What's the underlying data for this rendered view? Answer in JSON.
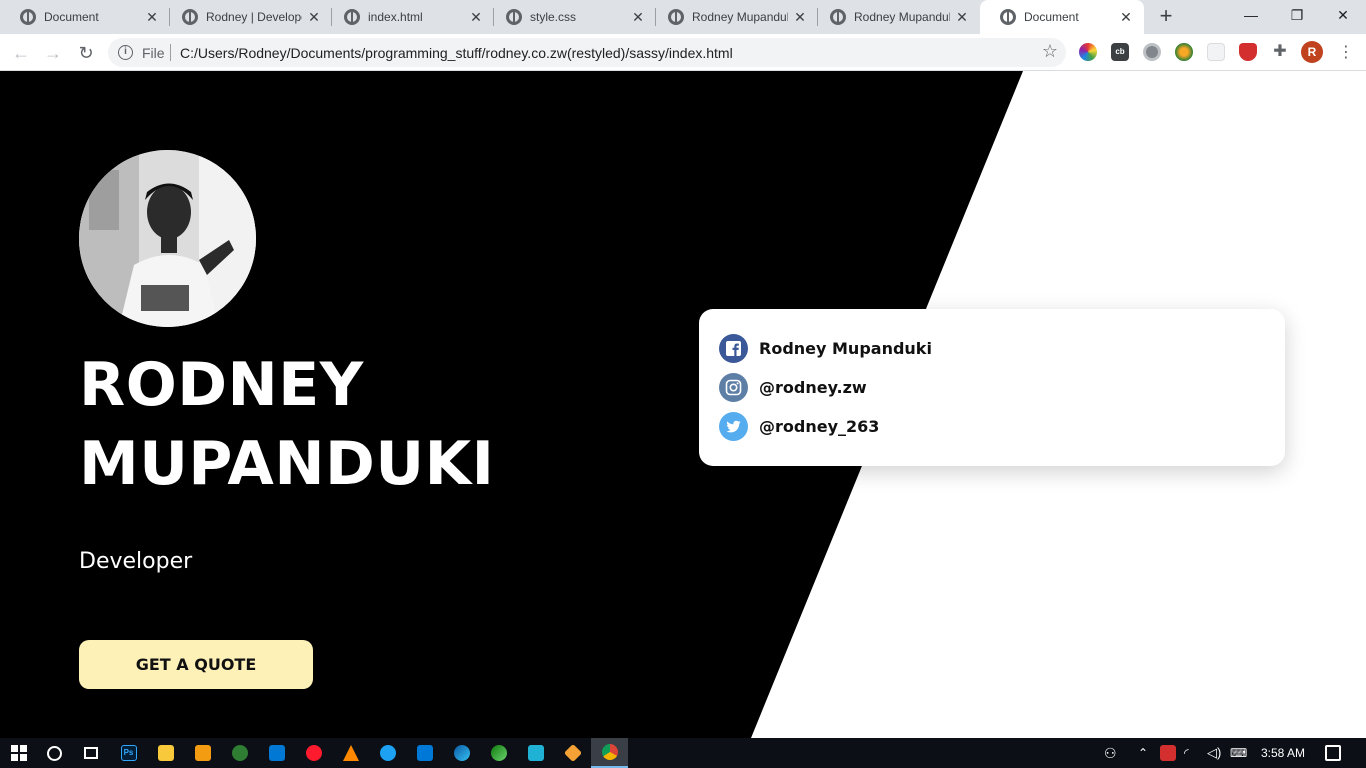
{
  "browser": {
    "tabs": [
      {
        "title": "Document",
        "active": false
      },
      {
        "title": "Rodney | Developer",
        "active": false
      },
      {
        "title": "index.html",
        "active": false
      },
      {
        "title": "style.css",
        "active": false
      },
      {
        "title": "Rodney Mupanduki",
        "active": false
      },
      {
        "title": "Rodney Mupanduki",
        "active": false
      },
      {
        "title": "Document",
        "active": true
      }
    ],
    "new_tab_symbol": "+",
    "window_controls": {
      "minimize": "—",
      "restore": "❐",
      "close": "✕"
    },
    "address": {
      "scheme_label": "File",
      "url": "C:/Users/Rodney/Documents/programming_stuff/rodney.co.zw(restyled)/sassy/index.html"
    },
    "profile_initial": "R",
    "extension_icons": [
      "color-wheel-icon",
      "cb-icon",
      "gear-extension-icon",
      "globe-extension-icon",
      "blank-extension-icon",
      "shield-icon",
      "puzzle-icon"
    ]
  },
  "page": {
    "name_line1": "RODNEY",
    "name_line2": "MUPANDUKI",
    "role": "Developer",
    "cta": "GET A QUOTE",
    "colors": {
      "dark": "#000000",
      "cta_bg": "#fdf1b8",
      "facebook": "#3b5998",
      "instagram": "#5d7fa6",
      "twitter": "#55acee"
    },
    "socials": [
      {
        "network": "facebook",
        "icon": "facebook-icon",
        "label": "Rodney Mupanduki"
      },
      {
        "network": "instagram",
        "icon": "instagram-icon",
        "label": "@rodney.zw"
      },
      {
        "network": "twitter",
        "icon": "twitter-icon",
        "label": "@rodney_263"
      }
    ]
  },
  "taskbar": {
    "apps": [
      "windows-start-icon",
      "cortana-search-icon",
      "task-view-icon",
      "photoshop-icon",
      "file-explorer-icon",
      "media-player-icon",
      "green-app-icon",
      "mail-icon",
      "opera-icon",
      "vlc-icon",
      "twitter-app-icon",
      "vscode-icon",
      "edge-icon",
      "edge-dev-icon",
      "camera-app-icon",
      "git-icon",
      "chrome-icon"
    ],
    "time": "3:58 AM"
  }
}
